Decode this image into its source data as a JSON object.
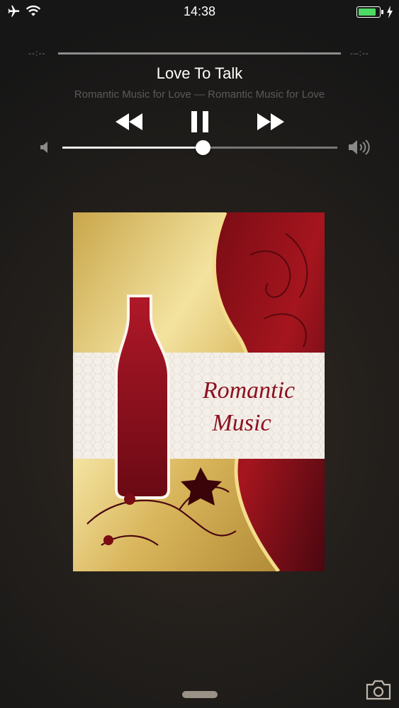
{
  "status_bar": {
    "time": "14:38",
    "battery_level": 0.88,
    "icons": [
      "airplane-icon",
      "wifi-icon",
      "battery-icon",
      "charging-bolt-icon"
    ]
  },
  "player": {
    "elapsed": "--:--",
    "remaining": "-–:--",
    "song_title": "Love To Talk",
    "artist_album": "Romantic Music for Love — Romantic Music for Love",
    "volume_level": 0.51,
    "controls": [
      "rewind-icon",
      "pause-icon",
      "fast-forward-icon"
    ]
  },
  "artwork": {
    "line1": "Romantic",
    "line2": "Music"
  },
  "colors": {
    "accent_green": "#4cd964",
    "wine_red": "#8c1020",
    "gold": "#e0c76a"
  }
}
